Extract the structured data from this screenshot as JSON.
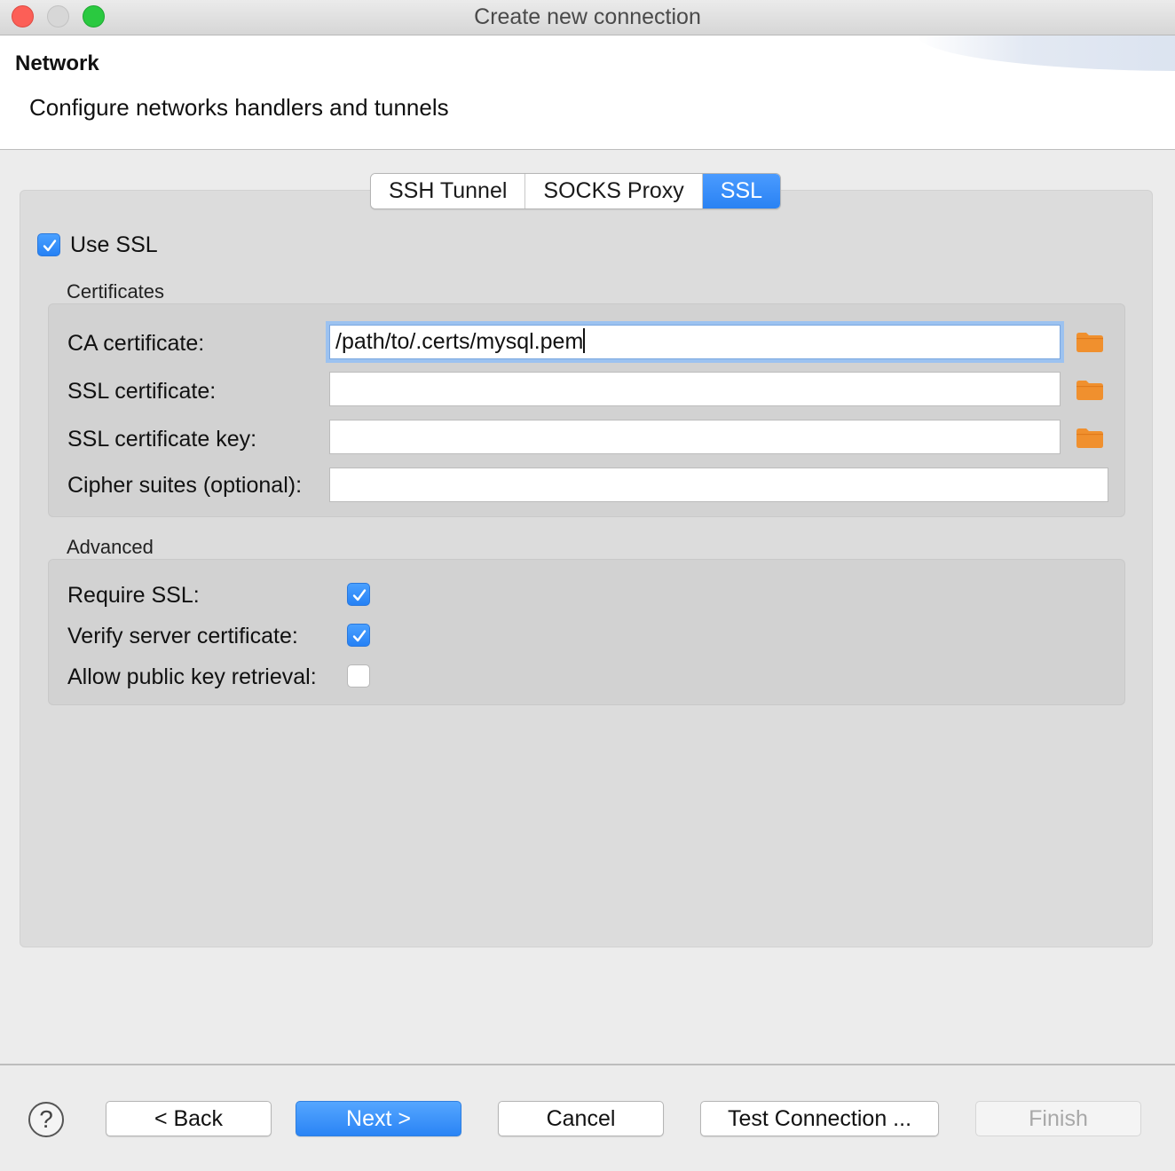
{
  "window": {
    "title": "Create new connection"
  },
  "header": {
    "title": "Network",
    "description": "Configure networks handlers and tunnels"
  },
  "tabs": [
    {
      "label": "SSH Tunnel",
      "active": false
    },
    {
      "label": "SOCKS Proxy",
      "active": false
    },
    {
      "label": "SSL",
      "active": true
    }
  ],
  "use_ssl": {
    "label": "Use SSL",
    "checked": true
  },
  "certificates": {
    "title": "Certificates",
    "ca_certificate": {
      "label": "CA certificate:",
      "value": "/path/to/.certs/mysql.pem"
    },
    "ssl_certificate": {
      "label": "SSL certificate:",
      "value": ""
    },
    "ssl_certificate_key": {
      "label": "SSL certificate key:",
      "value": ""
    },
    "cipher_suites": {
      "label": "Cipher suites (optional):",
      "value": ""
    }
  },
  "advanced": {
    "title": "Advanced",
    "require_ssl": {
      "label": "Require SSL:",
      "checked": true
    },
    "verify_server_certificate": {
      "label": "Verify server certificate:",
      "checked": true
    },
    "allow_public_key_retrieval": {
      "label": "Allow public key retrieval:",
      "checked": false
    }
  },
  "buttons": {
    "help": "?",
    "back": "< Back",
    "next": "Next >",
    "cancel": "Cancel",
    "test_connection": "Test Connection ...",
    "finish": "Finish"
  },
  "colors": {
    "accent": "#2a82f3",
    "folder_icon": "#f0902e",
    "close": "#fc5f57",
    "maximize": "#2ac940"
  }
}
